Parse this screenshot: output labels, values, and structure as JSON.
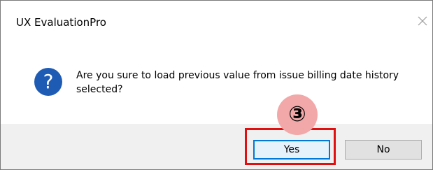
{
  "dialog": {
    "title": "UX EvaluationPro",
    "close_icon": "close-icon",
    "message": "Are you sure to load previous value from issue billing date history selected?",
    "icon": "question-icon",
    "icon_glyph": "?",
    "buttons": {
      "yes": "Yes",
      "no": "No"
    }
  },
  "annotation": {
    "step_number": "③",
    "highlight_color": "#e01010",
    "badge_color": "#f2a8a8"
  },
  "colors": {
    "accent": "#0078d7",
    "icon_blue": "#1e5bb5",
    "footer_bg": "#f0f0f0"
  }
}
